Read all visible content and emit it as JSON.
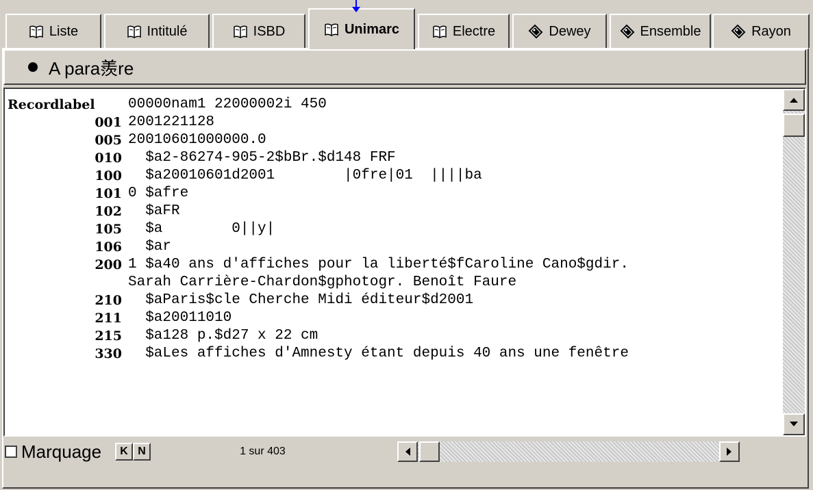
{
  "tabs": [
    {
      "label": "Liste",
      "icon": "book-icon"
    },
    {
      "label": "Intitulé",
      "icon": "book-icon"
    },
    {
      "label": "ISBD",
      "icon": "book-icon"
    },
    {
      "label": "Unimarc",
      "icon": "book-icon",
      "active": true
    },
    {
      "label": "Electre",
      "icon": "book-icon"
    },
    {
      "label": "Dewey",
      "icon": "tag-icon"
    },
    {
      "label": "Ensemble",
      "icon": "tag-icon"
    },
    {
      "label": "Rayon",
      "icon": "tag-icon"
    }
  ],
  "section": {
    "title": "A para羨re"
  },
  "record": {
    "lines": [
      {
        "tag": "Recordlabel",
        "value": "00000nam1 22000002i 450"
      },
      {
        "tag": "001",
        "value": "2001221128"
      },
      {
        "tag": "005",
        "value": "20010601000000.0"
      },
      {
        "tag": "010",
        "value": "  $a2-86274-905-2$bBr.$d148 FRF"
      },
      {
        "tag": "100",
        "value": "  $a20010601d2001        |0fre|01  ||||ba"
      },
      {
        "tag": "101",
        "value": "0 $afre"
      },
      {
        "tag": "102",
        "value": "  $aFR"
      },
      {
        "tag": "105",
        "value": "  $a        0||y|"
      },
      {
        "tag": "106",
        "value": "  $ar"
      },
      {
        "tag": "200",
        "value": "1 $a40 ans d'affiches pour la liberté$fCaroline Cano$gdir."
      },
      {
        "tag": "",
        "value": "Sarah Carrière-Chardon$gphotogr. Benoît Faure"
      },
      {
        "tag": "210",
        "value": "  $aParis$cle Cherche Midi éditeur$d2001"
      },
      {
        "tag": "211",
        "value": "  $a20011010"
      },
      {
        "tag": "215",
        "value": "  $a128 p.$d27 x 22 cm"
      },
      {
        "tag": "330",
        "value": "  $aLes affiches d'Amnesty étant depuis 40 ans une fenêtre"
      }
    ]
  },
  "footer": {
    "marquage_label": "Marquage",
    "first_label": "K",
    "next_label": "N",
    "counter": "1 sur 403"
  }
}
